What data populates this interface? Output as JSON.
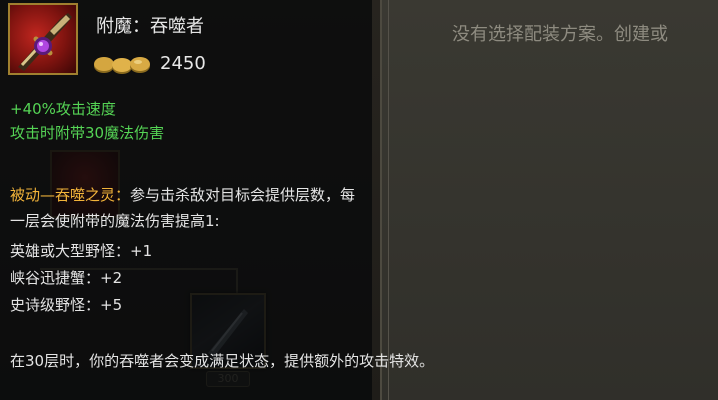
{
  "background": {
    "message": "没有选择配装方案。创建或",
    "slot_price": "300"
  },
  "item": {
    "name": "附魔：吞噬者",
    "cost": "2450",
    "icon": "enchanted-sword-icon",
    "stats": [
      "+40%攻击速度",
      "攻击时附带30魔法伤害"
    ]
  },
  "passive": {
    "name": "被动—吞噬之灵：",
    "description": "参与击杀敌对目标会提供层数，每一层会使附带的魔法伤害提高1:",
    "bonuses": [
      "英雄或大型野怪：+1",
      "峡谷迅捷蟹：+2",
      "史诗级野怪：+5"
    ],
    "final": "在30层时，你的吞噬者会变成满足状态，提供额外的攻击特效。"
  },
  "colors": {
    "stat_green": "#55d455",
    "passive_gold": "#f2b43a",
    "text_white": "#e4e4e4",
    "icon_border": "#a0802f"
  }
}
